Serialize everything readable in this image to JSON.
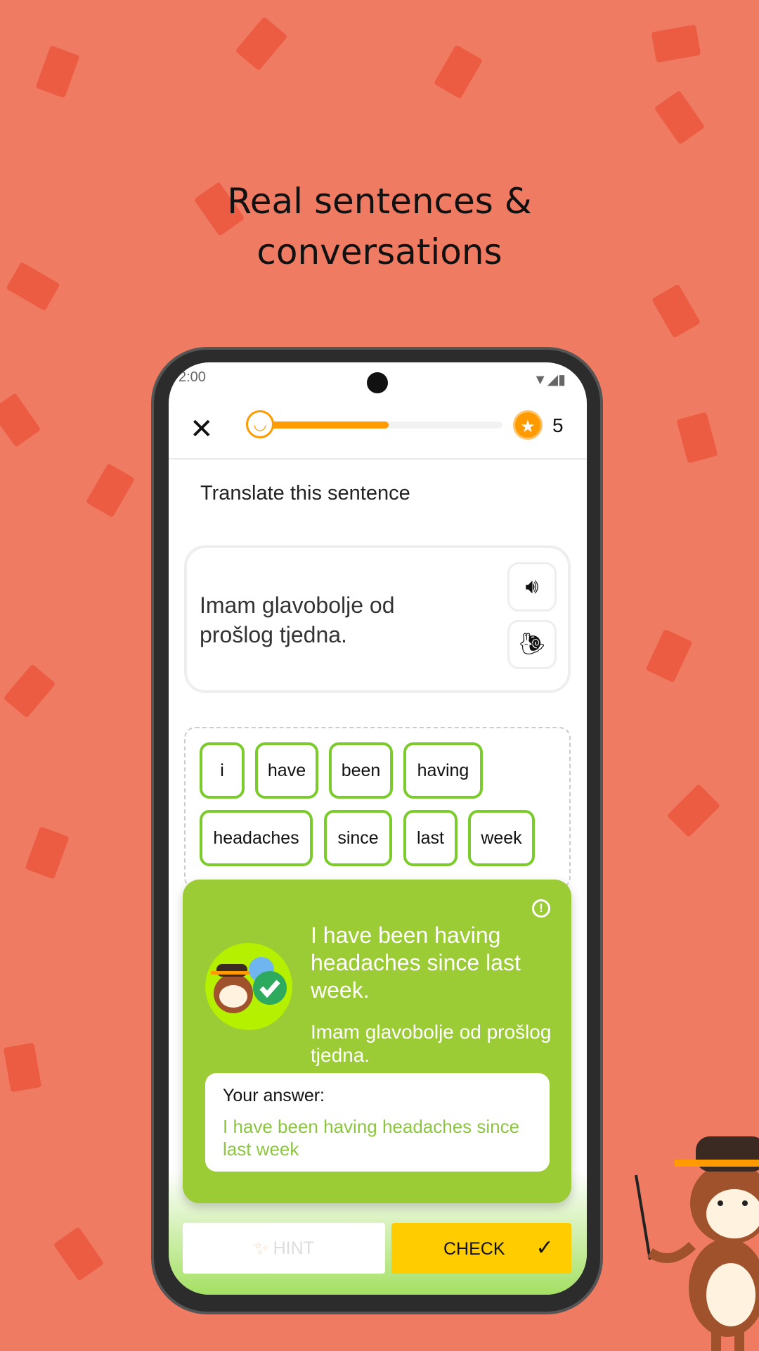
{
  "headline": [
    "Real sentences &",
    "conversations"
  ],
  "status": {
    "time": "2:00",
    "icons": [
      "wifi-icon",
      "signal-icon",
      "battery-icon"
    ]
  },
  "header": {
    "progress_percent": 55,
    "coins": "5"
  },
  "exercise": {
    "prompt": "Translate this sentence",
    "sentence": "Imam glavobolje od prošlog tjedna.",
    "words": [
      "i",
      "have",
      "been",
      "having",
      "headaches",
      "since",
      "last",
      "week"
    ]
  },
  "feedback": {
    "translation": "I have been having headaches since last week.",
    "original": "Imam glavobolje od prošlog tjedna.",
    "answer_label": "Your answer:",
    "answer": "I have been having headaches since last week"
  },
  "buttons": {
    "hint": "HINT",
    "check": "CHECK"
  },
  "colors": {
    "background": "#EF7B63",
    "accent": "#FF9A00",
    "success": "#9BCB35",
    "check": "#FFCC00"
  }
}
